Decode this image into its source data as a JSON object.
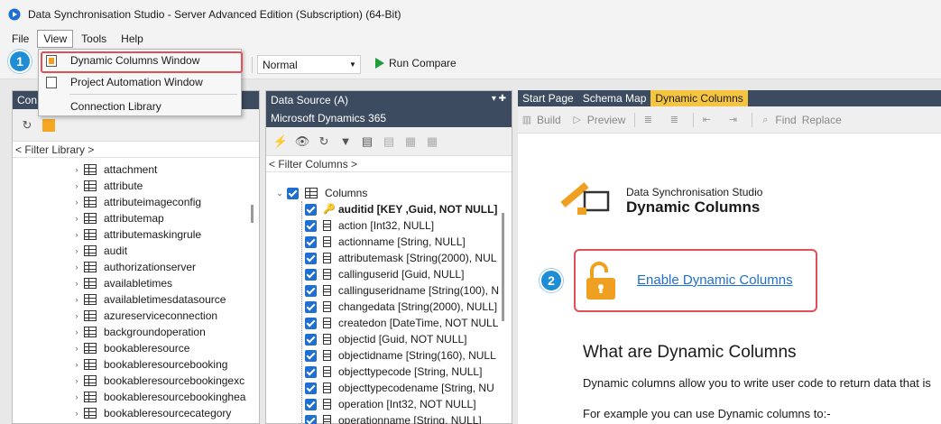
{
  "window": {
    "title": "Data Synchronisation Studio - Server Advanced Edition (Subscription) (64-Bit)"
  },
  "menu": {
    "items": [
      "File",
      "View",
      "Tools",
      "Help"
    ]
  },
  "toolbar": {
    "zoom_value": "Normal",
    "run_compare_label": "Run Compare"
  },
  "view_menu": {
    "items": [
      "Dynamic Columns Window",
      "Project Automation Window",
      "Connection Library"
    ]
  },
  "left_panel": {
    "title": "Con",
    "filter_placeholder": "< Filter Library >",
    "items": [
      "attachment",
      "attribute",
      "attributeimageconfig",
      "attributemap",
      "attributemaskingrule",
      "audit",
      "authorizationserver",
      "availabletimes",
      "availabletimesdatasource",
      "azureserviceconnection",
      "backgroundoperation",
      "bookableresource",
      "bookableresourcebooking",
      "bookableresourcebookingexc",
      "bookableresourcebookinghea",
      "bookableresourcecategory"
    ]
  },
  "mid_panel": {
    "title": "Data Source (A)",
    "source": "Microsoft Dynamics 365",
    "filter_placeholder": "< Filter Columns >",
    "root_label": "Columns",
    "columns": [
      "auditid [KEY ,Guid, NOT NULL]",
      "action [Int32, NULL]",
      "actionname [String, NULL]",
      "attributemask [String(2000), NUL",
      "callinguserid [Guid, NULL]",
      "callinguseridname [String(100), N",
      "changedata [String(2000), NULL]",
      "createdon [DateTime, NOT NULL",
      "objectid [Guid, NOT NULL]",
      "objectidname [String(160), NULL",
      "objecttypecode [String, NULL]",
      "objecttypecodename [String, NU",
      "operation [Int32, NOT NULL]",
      "operationname [String, NULL]"
    ]
  },
  "right_panel": {
    "tabs": [
      "Start Page",
      "Schema Map",
      "Dynamic Columns"
    ],
    "active_tab": 2,
    "toolbar": {
      "build": "Build",
      "preview": "Preview",
      "find": "Find",
      "replace": "Replace"
    },
    "brand_sub": "Data Synchronisation Studio",
    "brand_title": "Dynamic Columns",
    "enable_link": "Enable Dynamic Columns",
    "what_heading": "What are Dynamic Columns",
    "what_body": "Dynamic columns allow you to write user code to return data that is",
    "what_example": "For example you can use Dynamic columns to:-"
  },
  "badges": [
    "1",
    "2"
  ],
  "colors": {
    "accent": "#1f6fd1",
    "highlight": "#e05058",
    "tab_active": "#f5c542",
    "panel_header": "#3c4b5f",
    "brand_orange": "#f0a020"
  }
}
